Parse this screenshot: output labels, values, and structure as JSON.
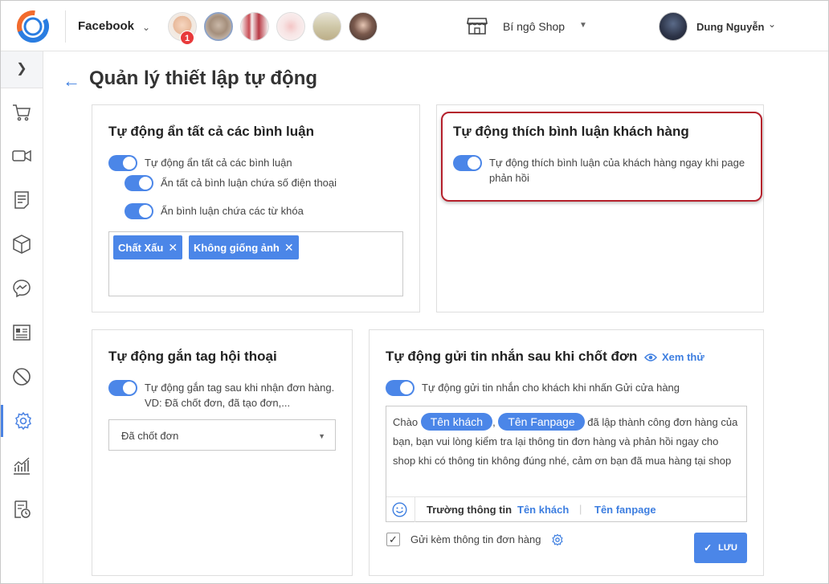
{
  "header": {
    "platform": "Facebook",
    "notification_count": "1",
    "shop_name": "Bí ngô Shop",
    "user_name": "Dung Nguyễn"
  },
  "page": {
    "title": "Quản lý thiết lập tự động"
  },
  "card_hide": {
    "title": "Tự động ẩn tất cả các bình luận",
    "option_all": "Tự động ẩn tất cả các bình luận",
    "option_phone": "Ẩn tất cả bình luận chứa số điện thoại",
    "option_keywords": "Ẩn bình luận chứa các từ khóa",
    "keywords": [
      "Chất Xấu",
      "Không giống ảnh"
    ]
  },
  "card_like": {
    "title": "Tự động thích bình luận khách hàng",
    "option": "Tự động thích bình luận của khách hàng ngay khi page phản hồi"
  },
  "card_tag": {
    "title": "Tự động gắn tag hội thoại",
    "option": "Tự động gắn tag sau khi nhận đơn hàng. VD: Đã chốt đơn, đã tạo đơn,...",
    "selected_tag": "Đã chốt đơn"
  },
  "card_message": {
    "title": "Tự động gửi tin nhắn sau khi chốt đơn",
    "preview_label": "Xem thử",
    "option": "Tự động gửi tin nhắn cho khách khi nhấn Gửi cửa hàng",
    "msg_prefix": "Chào",
    "pill_customer": "Tên khách",
    "msg_comma": ",",
    "pill_fanpage": "Tên Fanpage",
    "msg_body": "đã lập thành công đơn hàng của bạn, bạn vui lòng kiểm tra lại thông tin đơn hàng và phản hồi ngay cho shop khi có thông tin không đúng nhé, cảm ơn bạn đã mua hàng tại shop",
    "fields_label": "Trường thông tin",
    "field_customer": "Tên khách",
    "field_fanpage": "Tên fanpage",
    "attach_label": "Gửi kèm thông tin đơn hàng",
    "save_label": "LƯU"
  },
  "colors": {
    "accent": "#4b86e8",
    "highlight": "#b5202c",
    "badge": "#e8393a"
  }
}
